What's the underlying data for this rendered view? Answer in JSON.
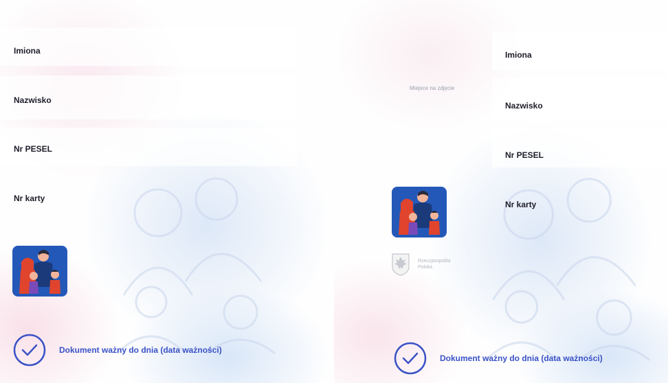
{
  "left_card": {
    "fields": {
      "first_names": "Imiona",
      "surname": "Nazwisko",
      "pesel": "Nr PESEL",
      "card_number": "Nr karty"
    },
    "validity_text": "Dokument ważny do dnia (data ważności)"
  },
  "right_card": {
    "photo_placeholder": "Miejsce na zdjęcie",
    "fields": {
      "first_names": "Imiona",
      "surname": "Nazwisko",
      "pesel": "Nr PESEL",
      "card_number": "Nr karty"
    },
    "emblem_caption": "Rzeczpospolita Polska",
    "validity_text": "Dokument ważny do dnia (data ważności)"
  },
  "icons": [
    "family-logo-icon",
    "check-circle-icon",
    "polish-eagle-emblem-icon"
  ],
  "colors": {
    "accent_blue": "#3a52c6",
    "label_text": "#1d1d2a",
    "logo_background": "#2458b8",
    "pastel_pink": "#f5d7e4",
    "pastel_blue": "#d2e1f5"
  }
}
